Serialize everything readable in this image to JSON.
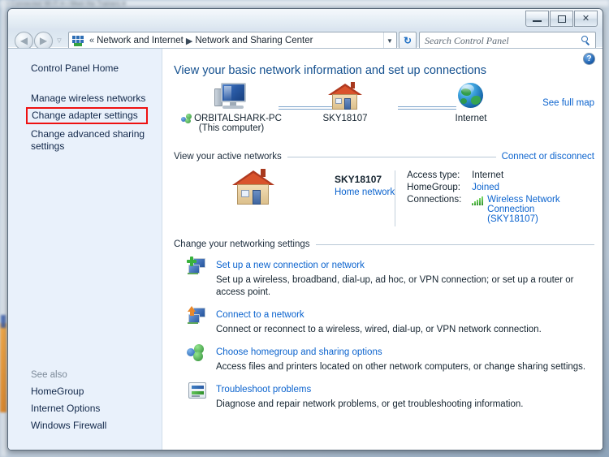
{
  "desktop": {
    "background_top_items": "▪ Connected  Wi-Fi  ▾        ▪ Meet the Trainers  ▾"
  },
  "window": {
    "caption": {
      "minimize_label": "Minimize",
      "maximize_label": "Maximize",
      "close_label": "Close",
      "close_glyph": "✕"
    },
    "nav": {
      "back_label": "Back",
      "back_glyph": "◀",
      "forward_label": "Forward",
      "forward_glyph": "▶",
      "recent_pages_glyph": "▽",
      "breadcrumb_icon": "network-places-icon",
      "breadcrumb_prefix": "«",
      "crumbs": [
        {
          "label": "Network and Internet"
        },
        {
          "label": "Network and Sharing Center"
        }
      ],
      "crumb_separator": "▶",
      "address_dropdown_glyph": "▼",
      "refresh_glyph": "↻",
      "refresh_label": "Refresh"
    },
    "search": {
      "placeholder": "Search Control Panel",
      "value": ""
    }
  },
  "sidebar": {
    "home_label": "Control Panel Home",
    "items": [
      {
        "label": "Manage wireless networks"
      },
      {
        "label": "Change adapter settings",
        "highlighted": true
      },
      {
        "label": "Change advanced sharing settings"
      }
    ],
    "see_also_title": "See also",
    "see_also": [
      {
        "label": "HomeGroup"
      },
      {
        "label": "Internet Options"
      },
      {
        "label": "Windows Firewall"
      }
    ],
    "highlight_color": "#ee1111"
  },
  "content": {
    "help_glyph": "?",
    "help_label": "Help",
    "heading": "View your basic network information and set up connections",
    "netmap": {
      "see_full_map": "See full map",
      "nodes": [
        {
          "icon": "computer-monitor-icon",
          "label": "ORBITALSHARK-PC",
          "sublabel": "(This computer)"
        },
        {
          "icon": "house-icon",
          "label": "SKY18107",
          "sublabel": ""
        },
        {
          "icon": "globe-icon",
          "label": "Internet",
          "sublabel": ""
        }
      ]
    },
    "active_networks": {
      "section_title": "View your active networks",
      "right_link": "Connect or disconnect",
      "network_name": "SKY18107",
      "network_type": "Home network",
      "properties": [
        {
          "key": "Access type:",
          "value": "Internet",
          "is_link": false
        },
        {
          "key": "HomeGroup:",
          "value": "Joined",
          "is_link": true
        },
        {
          "key": "Connections:",
          "value": "Wireless Network Connection",
          "value2": "(SKY18107)",
          "is_link": true,
          "icon": "wifi-signal-icon"
        }
      ]
    },
    "change_settings": {
      "section_title": "Change your networking settings",
      "items": [
        {
          "icon": "add-connection-icon",
          "title": "Set up a new connection or network",
          "desc": "Set up a wireless, broadband, dial-up, ad hoc, or VPN connection; or set up a router or access point."
        },
        {
          "icon": "connect-network-icon",
          "title": "Connect to a network",
          "desc": "Connect or reconnect to a wireless, wired, dial-up, or VPN network connection."
        },
        {
          "icon": "homegroup-icon",
          "title": "Choose homegroup and sharing options",
          "desc": "Access files and printers located on other network computers, or change sharing settings."
        },
        {
          "icon": "troubleshoot-icon",
          "title": "Troubleshoot problems",
          "desc": "Diagnose and repair network problems, or get troubleshooting information."
        }
      ]
    }
  }
}
